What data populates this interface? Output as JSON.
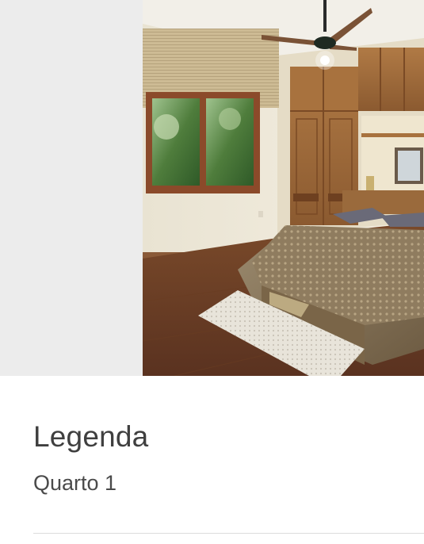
{
  "caption": {
    "heading": "Legenda",
    "text": "Quarto 1"
  }
}
